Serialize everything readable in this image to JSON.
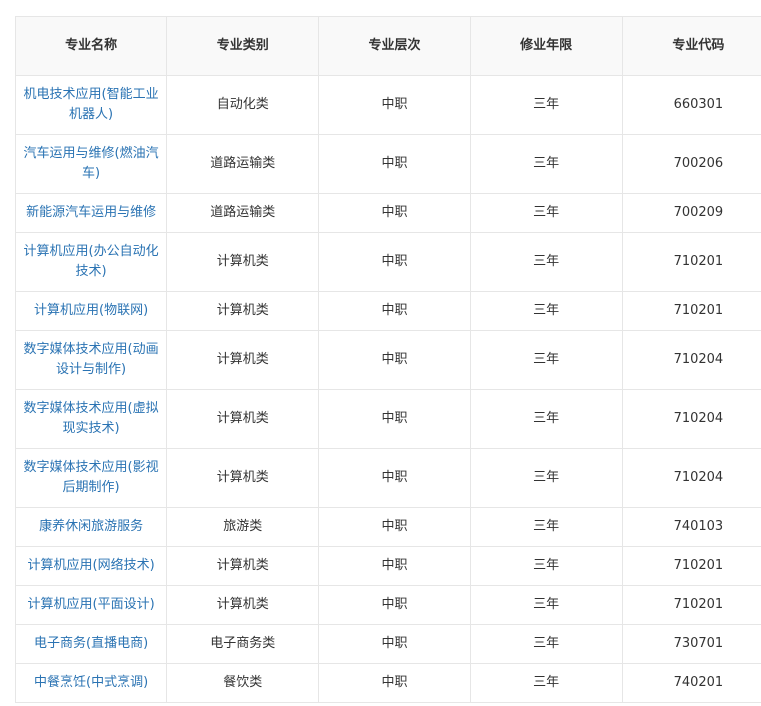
{
  "table": {
    "headers": [
      "专业名称",
      "专业类别",
      "专业层次",
      "修业年限",
      "专业代码"
    ],
    "rows": [
      {
        "name": "机电技术应用(智能工业机器人)",
        "category": "自动化类",
        "level": "中职",
        "years": "三年",
        "code": "660301"
      },
      {
        "name": "汽车运用与维修(燃油汽车)",
        "category": "道路运输类",
        "level": "中职",
        "years": "三年",
        "code": "700206"
      },
      {
        "name": "新能源汽车运用与维修",
        "category": "道路运输类",
        "level": "中职",
        "years": "三年",
        "code": "700209"
      },
      {
        "name": "计算机应用(办公自动化技术)",
        "category": "计算机类",
        "level": "中职",
        "years": "三年",
        "code": "710201"
      },
      {
        "name": "计算机应用(物联网)",
        "category": "计算机类",
        "level": "中职",
        "years": "三年",
        "code": "710201"
      },
      {
        "name": "数字媒体技术应用(动画设计与制作)",
        "category": "计算机类",
        "level": "中职",
        "years": "三年",
        "code": "710204"
      },
      {
        "name": "数字媒体技术应用(虚拟现实技术)",
        "category": "计算机类",
        "level": "中职",
        "years": "三年",
        "code": "710204"
      },
      {
        "name": "数字媒体技术应用(影视后期制作)",
        "category": "计算机类",
        "level": "中职",
        "years": "三年",
        "code": "710204"
      },
      {
        "name": "康养休闲旅游服务",
        "category": "旅游类",
        "level": "中职",
        "years": "三年",
        "code": "740103"
      },
      {
        "name": "计算机应用(网络技术)",
        "category": "计算机类",
        "level": "中职",
        "years": "三年",
        "code": "710201"
      },
      {
        "name": "计算机应用(平面设计)",
        "category": "计算机类",
        "level": "中职",
        "years": "三年",
        "code": "710201"
      },
      {
        "name": "电子商务(直播电商)",
        "category": "电子商务类",
        "level": "中职",
        "years": "三年",
        "code": "730701"
      },
      {
        "name": "中餐烹饪(中式烹调)",
        "category": "餐饮类",
        "level": "中职",
        "years": "三年",
        "code": "740201"
      }
    ]
  },
  "colors": {
    "link": "#2a73b3",
    "text": "#333333",
    "border": "#e6e6e6",
    "header_bg": "#f9f9f9"
  }
}
